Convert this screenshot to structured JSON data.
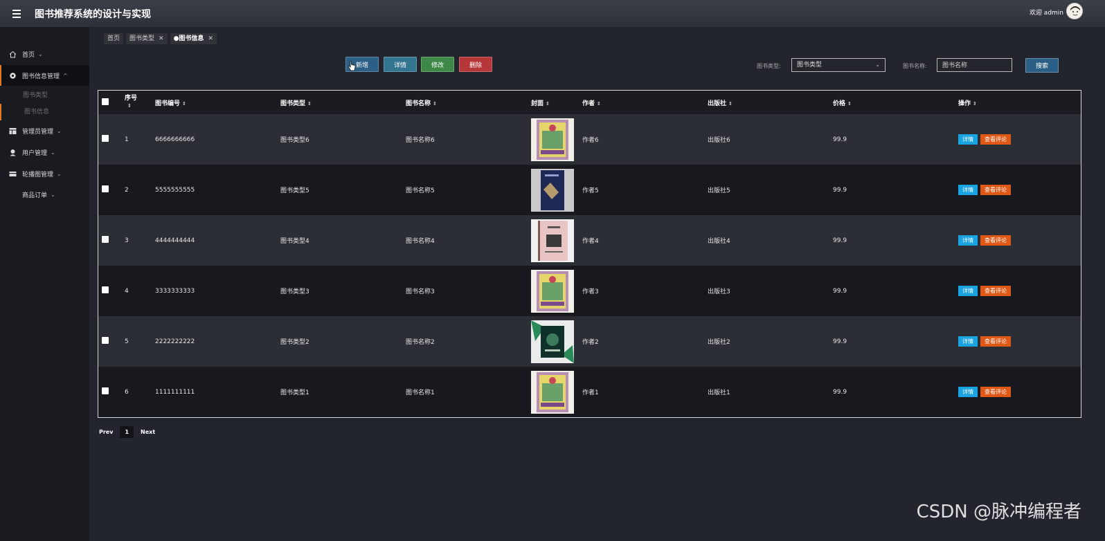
{
  "app": {
    "title": "图书推荐系统的设计与实现",
    "welcome": "欢迎 admin"
  },
  "sidebar": {
    "items": [
      {
        "label": "首页",
        "icon": "home-icon"
      },
      {
        "label": "图书信息管理",
        "icon": "gear-icon",
        "expanded": true
      },
      {
        "label": "管理员管理",
        "icon": "table-icon"
      },
      {
        "label": "用户管理",
        "icon": "user-icon"
      },
      {
        "label": "轮播图管理",
        "icon": "card-icon"
      },
      {
        "label": "商品订单",
        "icon": ""
      }
    ],
    "sub_items": [
      "图书类型",
      "图书信息"
    ]
  },
  "tabs": [
    {
      "label": "首页",
      "closable": false
    },
    {
      "label": "图书类型",
      "closable": true
    },
    {
      "label": "●图书信息",
      "closable": true,
      "active": true
    }
  ],
  "toolbar": {
    "add": "新增",
    "detail": "详情",
    "edit": "修改",
    "delete": "删除"
  },
  "filters": {
    "type_label": "图书类型:",
    "type_value": "图书类型",
    "name_label": "图书名称:",
    "name_placeholder": "图书名称",
    "search": "搜索"
  },
  "table": {
    "headers": [
      "序号",
      "图书编号",
      "图书类型",
      "图书名称",
      "封面",
      "作者",
      "出版社",
      "价格",
      "操作"
    ],
    "rows": [
      {
        "index": "1",
        "code": "6666666666",
        "type": "图书类型6",
        "name": "图书名称6",
        "author": "作者6",
        "publisher": "出版社6",
        "price": "99.9"
      },
      {
        "index": "2",
        "code": "5555555555",
        "type": "图书类型5",
        "name": "图书名称5",
        "author": "作者5",
        "publisher": "出版社5",
        "price": "99.9"
      },
      {
        "index": "3",
        "code": "4444444444",
        "type": "图书类型4",
        "name": "图书名称4",
        "author": "作者4",
        "publisher": "出版社4",
        "price": "99.9"
      },
      {
        "index": "4",
        "code": "3333333333",
        "type": "图书类型3",
        "name": "图书名称3",
        "author": "作者3",
        "publisher": "出版社3",
        "price": "99.9"
      },
      {
        "index": "5",
        "code": "2222222222",
        "type": "图书类型2",
        "name": "图书名称2",
        "author": "作者2",
        "publisher": "出版社2",
        "price": "99.9"
      },
      {
        "index": "6",
        "code": "1111111111",
        "type": "图书类型1",
        "name": "图书名称1",
        "author": "作者1",
        "publisher": "出版社1",
        "price": "99.9"
      }
    ],
    "op_detail": "详情",
    "op_review": "查看评论"
  },
  "pager": {
    "prev": "Prev",
    "current": "1",
    "next": "Next"
  },
  "watermark": "CSDN @脉冲编程者",
  "colors": {
    "accent": "#e07a1a",
    "add": "#2b5f85",
    "detail": "#33758f",
    "edit": "#3d8846",
    "delete": "#b5373a",
    "op_detail": "#19a3e0",
    "op_review": "#e05816"
  }
}
